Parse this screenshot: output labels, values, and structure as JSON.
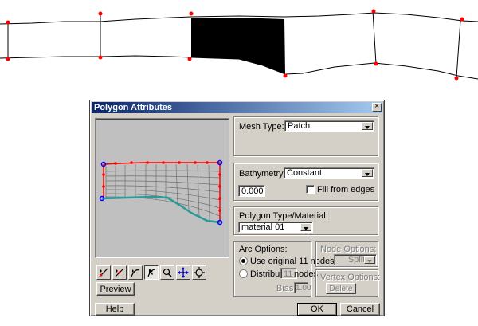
{
  "dialog": {
    "title": "Polygon Attributes",
    "close_label": "×"
  },
  "mesh": {
    "label": "Mesh Type:",
    "value": "Patch"
  },
  "bathymetry": {
    "label": "Bathymetry Type:",
    "value": "Constant",
    "elevation": "0.000",
    "fill_from_edges_label": "Fill from edges",
    "fill_from_edges_checked": false
  },
  "polygon_type": {
    "label": "Polygon Type/Material:",
    "value": "material 01"
  },
  "arc_options": {
    "label": "Arc Options:",
    "use_original_label": "Use original 11 nodes",
    "distribute_label": "Distribute",
    "distribute_value": "11",
    "nodes_label": "nodes",
    "bias_label": "Bias:",
    "bias_value": "1.00",
    "selected": "use_original"
  },
  "node_options": {
    "label": "Node Options:",
    "value": "Split"
  },
  "vertex_options": {
    "label": "Vertex Options:",
    "delete_label": "Delete"
  },
  "buttons": {
    "preview": "Preview",
    "help": "Help",
    "ok": "OK",
    "cancel": "Cancel"
  },
  "toolbar": {
    "tools": [
      "select-arc-icon",
      "split-arc-icon",
      "refine-arc-icon",
      "select-point-icon",
      "zoom-icon",
      "pan-icon",
      "frame-icon"
    ]
  },
  "colors": {
    "titlebar_start": "#0a246a",
    "titlebar_end": "#a6caf0",
    "arc_red": "#ff0000",
    "arc_teal": "#2a9a9a",
    "node_blue": "#0000ff",
    "dialog_face": "#d4d0c8"
  }
}
